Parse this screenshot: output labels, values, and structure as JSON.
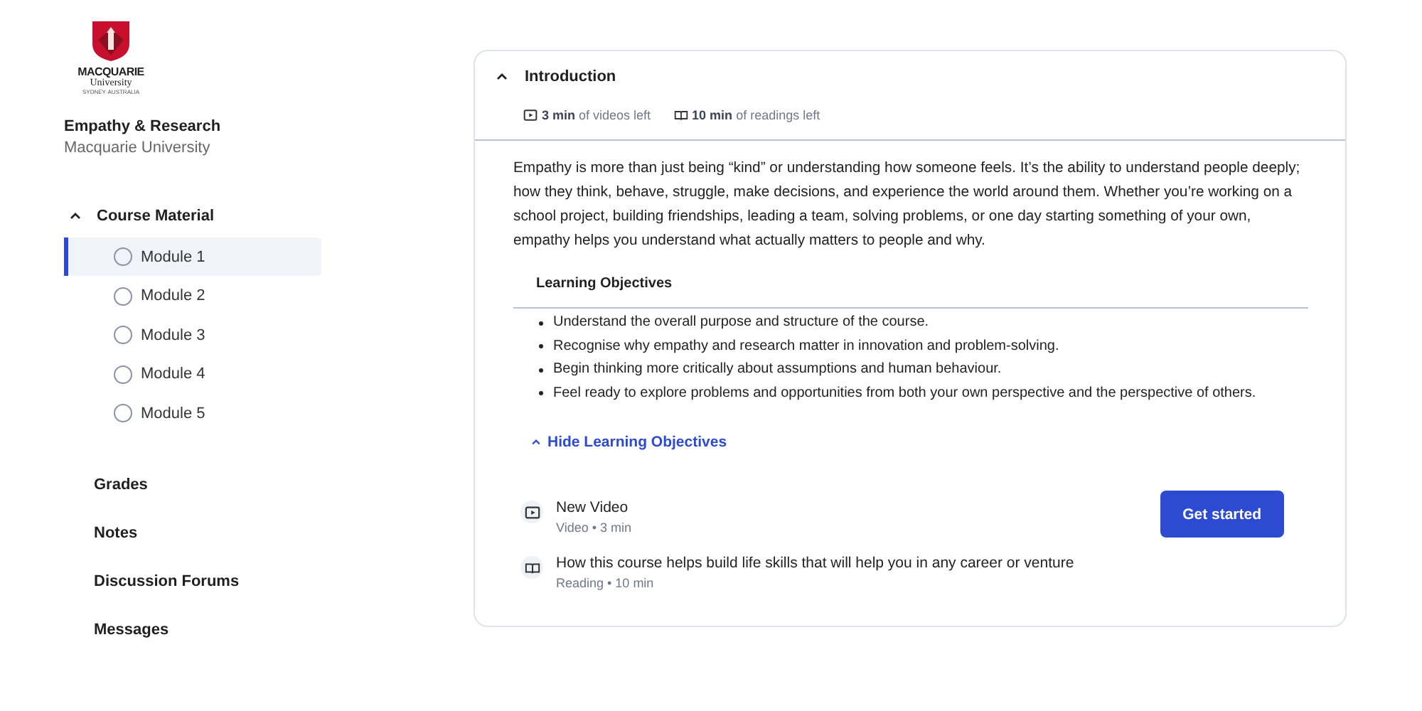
{
  "logo": {
    "name": "MACQUARIE",
    "subname": "University",
    "tagline": "SYDNEY·AUSTRALIA"
  },
  "course": {
    "title": "Empathy & Research",
    "provider": "Macquarie University"
  },
  "course_material": {
    "label": "Course Material",
    "expanded": true,
    "modules": [
      {
        "label": "Module 1",
        "selected": true
      },
      {
        "label": "Module 2",
        "selected": false
      },
      {
        "label": "Module 3",
        "selected": false
      },
      {
        "label": "Module 4",
        "selected": false
      },
      {
        "label": "Module 5",
        "selected": false
      }
    ]
  },
  "nav": [
    "Grades",
    "Notes",
    "Discussion Forums",
    "Messages"
  ],
  "section": {
    "title": "Introduction",
    "expanded": true,
    "stats": [
      {
        "kind": "video",
        "text": "**3 min** of videos left"
      },
      {
        "kind": "reading",
        "text": "**10 min** of readings left"
      }
    ],
    "description": "Empathy is more than just being “kind” or understanding how someone feels. It’s the ability to understand people deeply; how they think, behave, struggle, make decisions, and experience the world around them. Whether you’re working on a school project, building friendships, leading a team, solving problems, or one day starting something of your own, empathy helps you understand what actually matters to people and why.",
    "objectives_title": "Learning Objectives",
    "objectives": [
      "Understand the overall purpose and structure of the course.",
      "Recognise why empathy and research matter in innovation and problem-solving.",
      "Begin thinking more critically about assumptions and human behaviour.",
      "Feel ready to explore problems and opportunities from both your own perspective and the perspective of others."
    ],
    "objectives_toggle": {
      "label": "Hide Learning Objectives",
      "expanded": true
    },
    "items": [
      {
        "kind": "video",
        "title": "New Video",
        "meta": "Video • 3 min"
      },
      {
        "kind": "reading",
        "title": "How this course helps build life skills that will help you in any career or venture",
        "meta": "Reading • 10 min"
      }
    ],
    "action": "Get started"
  }
}
